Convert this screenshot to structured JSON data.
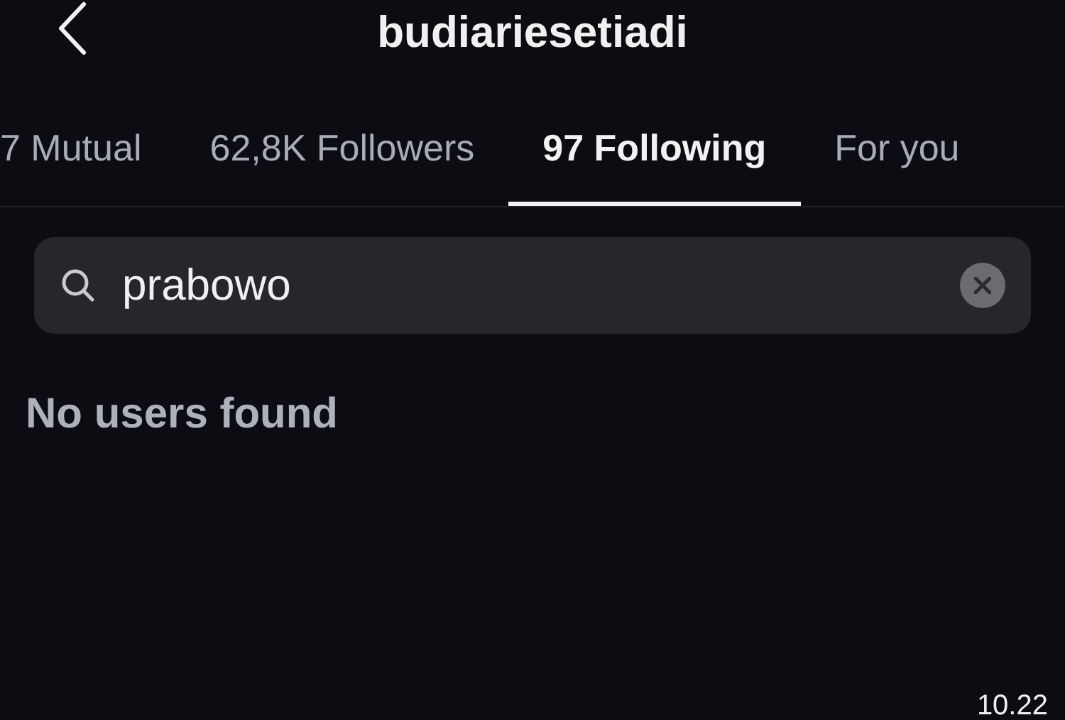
{
  "header": {
    "title": "budiariesetiadi"
  },
  "tabs": [
    {
      "label": "7 Mutual",
      "selected": false
    },
    {
      "label": "62,8K Followers",
      "selected": false
    },
    {
      "label": "97 Following",
      "selected": true
    },
    {
      "label": "For you",
      "selected": false
    }
  ],
  "search": {
    "value": "prabowo"
  },
  "empty_message": "No users found",
  "timestamp": "10.22"
}
